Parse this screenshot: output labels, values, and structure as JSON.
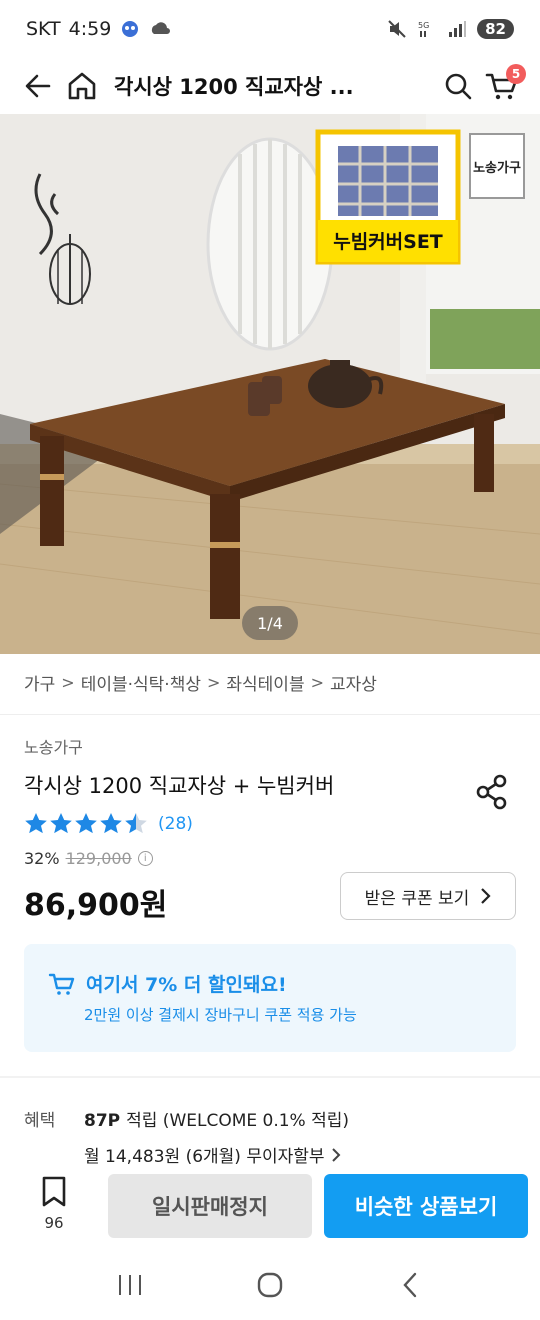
{
  "status_bar": {
    "carrier": "SKT",
    "time": "4:59",
    "battery": "82"
  },
  "header": {
    "title": "각시상 1200 직교자상 ...",
    "cart_count": "5"
  },
  "hero": {
    "pager": "1/4",
    "overlay_badge_text": "누빔커버SET",
    "logo_text": "노송가구"
  },
  "breadcrumb": [
    "가구",
    "테이블·식탁·책상",
    "좌식테이블",
    "교자상"
  ],
  "product": {
    "brand": "노송가구",
    "name": "각시상 1200 직교자상 + 누빔커버",
    "rating_value": 4.5,
    "rating_count": "(28)",
    "discount_pct": "32%",
    "original_price": "129,000",
    "price": "86,900원",
    "coupon_button": "받은 쿠폰 보기"
  },
  "promo": {
    "title": "여기서 7% 더 할인돼요!",
    "subtitle": "2만원 이상 결제시 장바구니 쿠폰 적용 가능"
  },
  "benefits": {
    "label": "혜택",
    "points_bold": "87P",
    "points_rest": "적립 (WELCOME 0.1% 적립)",
    "installment": "월 14,483원 (6개월) 무이자할부"
  },
  "action_bar": {
    "bookmark_count": "96",
    "stop_label": "일시판매정지",
    "similar_label": "비슷한 상품보기"
  },
  "colors": {
    "accent": "#139df2",
    "badge": "#f25c5c",
    "star": "#1e88e5"
  }
}
